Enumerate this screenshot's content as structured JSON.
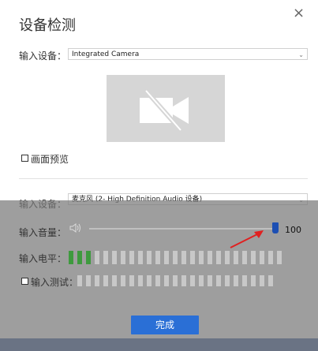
{
  "dialog": {
    "title": "设备检测",
    "close_glyph": "×",
    "done_button": "完成"
  },
  "camera": {
    "label": "输入设备：",
    "device": "Integrated Camera",
    "preview_label": "画面预览",
    "preview_checked": false,
    "icon": "camera-off-icon"
  },
  "audio": {
    "device_label": "输入设备：",
    "device": "麦克风 (2- High Definition Audio 设备)",
    "volume_label": "输入音量：",
    "volume_value": "100",
    "volume_fraction": 1.0,
    "level_label": "输入电平：",
    "level_segments_total": 25,
    "level_segments_active": 3,
    "test_label": "输入测试：",
    "test_checked": false,
    "test_segments_total": 23
  },
  "colors": {
    "accent": "#2a6fd6",
    "level_on": "#3e9a3e",
    "slider_thumb": "#1d4fb3",
    "annotation_arrow": "#e02020"
  }
}
